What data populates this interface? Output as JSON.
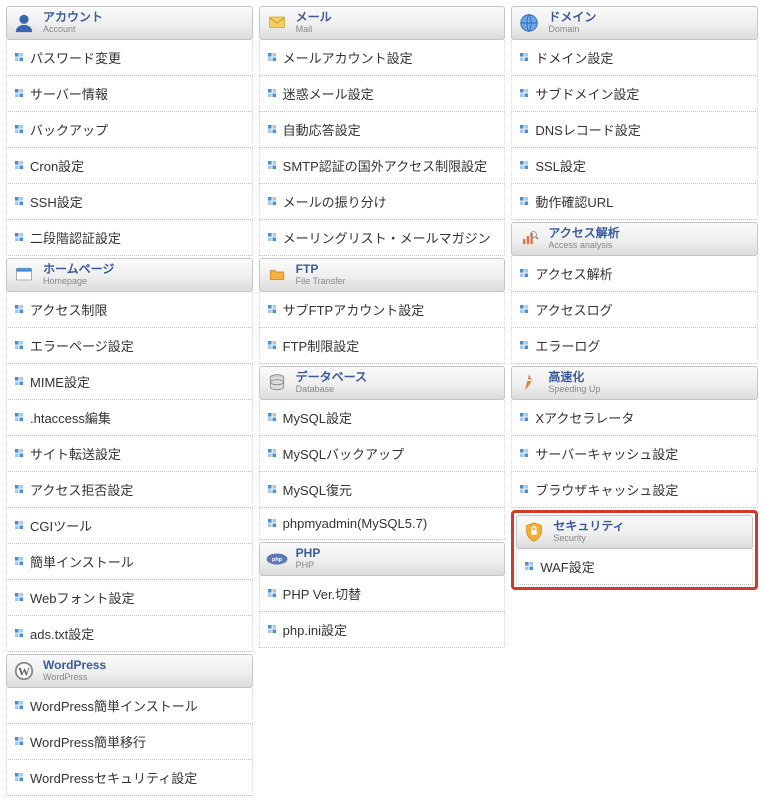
{
  "columns": [
    [
      {
        "id": "account",
        "title_jp": "アカウント",
        "title_en": "Account",
        "icon": "person-icon",
        "items": [
          "パスワード変更",
          "サーバー情報",
          "バックアップ",
          "Cron設定",
          "SSH設定",
          "二段階認証設定"
        ]
      },
      {
        "id": "homepage",
        "title_jp": "ホームページ",
        "title_en": "Homepage",
        "icon": "homepage-icon",
        "items": [
          "アクセス制限",
          "エラーページ設定",
          "MIME設定",
          ".htaccess編集",
          "サイト転送設定",
          "アクセス拒否設定",
          "CGIツール",
          "簡単インストール",
          "Webフォント設定",
          "ads.txt設定"
        ]
      },
      {
        "id": "wordpress",
        "title_jp": "WordPress",
        "title_en": "WordPress",
        "icon": "wordpress-icon",
        "items": [
          "WordPress簡単インストール",
          "WordPress簡単移行",
          "WordPressセキュリティ設定"
        ]
      }
    ],
    [
      {
        "id": "mail",
        "title_jp": "メール",
        "title_en": "Mail",
        "icon": "mail-icon",
        "items": [
          "メールアカウント設定",
          "迷惑メール設定",
          "自動応答設定",
          "SMTP認証の国外アクセス制限設定",
          "メールの振り分け",
          "メーリングリスト・メールマガジン"
        ]
      },
      {
        "id": "ftp",
        "title_jp": "FTP",
        "title_en": "File Transfer",
        "icon": "ftp-icon",
        "items": [
          "サブFTPアカウント設定",
          "FTP制限設定"
        ]
      },
      {
        "id": "database",
        "title_jp": "データベース",
        "title_en": "Database",
        "icon": "database-icon",
        "items": [
          "MySQL設定",
          "MySQLバックアップ",
          "MySQL復元",
          "phpmyadmin(MySQL5.7)"
        ]
      },
      {
        "id": "php",
        "title_jp": "PHP",
        "title_en": "PHP",
        "icon": "php-icon",
        "items": [
          "PHP Ver.切替",
          "php.ini設定"
        ]
      }
    ],
    [
      {
        "id": "domain",
        "title_jp": "ドメイン",
        "title_en": "Domain",
        "icon": "domain-icon",
        "items": [
          "ドメイン設定",
          "サブドメイン設定",
          "DNSレコード設定",
          "SSL設定",
          "動作確認URL"
        ]
      },
      {
        "id": "access",
        "title_jp": "アクセス解析",
        "title_en": "Access analysis",
        "icon": "access-icon",
        "items": [
          "アクセス解析",
          "アクセスログ",
          "エラーログ"
        ]
      },
      {
        "id": "speed",
        "title_jp": "高速化",
        "title_en": "Speeding Up",
        "icon": "speed-icon",
        "items": [
          "Xアクセラレータ",
          "サーバーキャッシュ設定",
          "ブラウザキャッシュ設定"
        ]
      },
      {
        "id": "security",
        "title_jp": "セキュリティ",
        "title_en": "Security",
        "icon": "security-icon",
        "highlight": true,
        "items": [
          "WAF設定"
        ]
      }
    ]
  ]
}
